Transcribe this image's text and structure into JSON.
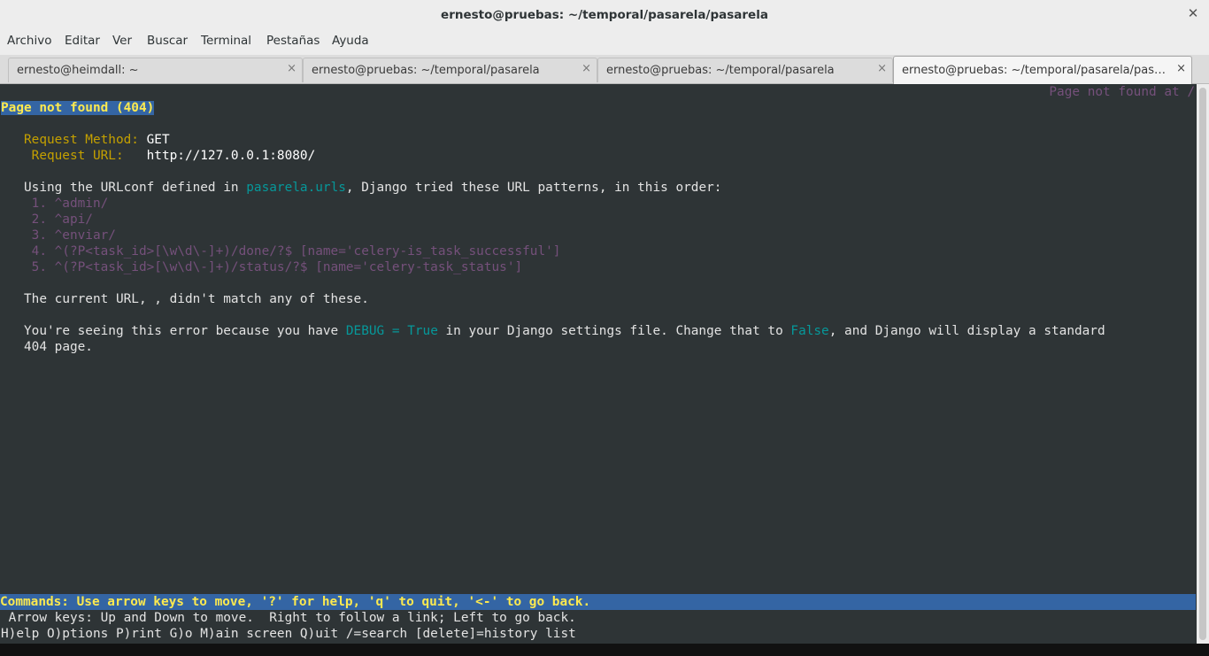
{
  "window": {
    "title": "ernesto@pruebas: ~/temporal/pasarela/pasarela",
    "close_glyph": "✕"
  },
  "menu": [
    "Archivo",
    "Editar",
    "Ver",
    "Buscar",
    "Terminal",
    "Pestañas",
    "Ayuda"
  ],
  "tabs": [
    {
      "label": "ernesto@heimdall: ~",
      "close": "×"
    },
    {
      "label": "ernesto@pruebas: ~/temporal/pasarela",
      "close": "×"
    },
    {
      "label": "ernesto@pruebas: ~/temporal/pasarela",
      "close": "×"
    },
    {
      "label": "ernesto@pruebas: ~/temporal/pasarela/pasarela",
      "close": "×",
      "active": true
    }
  ],
  "terminal": {
    "right_header": "Page not found at /",
    "heading": "Page not found (404)",
    "request_method_label": "Request Method:",
    "request_method_value": "GET",
    "request_url_label": "Request URL:",
    "request_url_value": "http://127.0.0.1:8080/",
    "urlconf_prefix": "Using the URLconf defined in ",
    "urlconf_module": "pasarela.urls",
    "urlconf_suffix": ", Django tried these URL patterns, in this order:",
    "patterns": [
      "1. ^admin/",
      "2. ^api/",
      "3. ^enviar/",
      "4. ^(?P<task_id>[\\w\\d\\-]+)/done/?$ [name='celery-is_task_successful']",
      "5. ^(?P<task_id>[\\w\\d\\-]+)/status/?$ [name='celery-task_status']"
    ],
    "no_match": "The current URL, , didn't match any of these.",
    "debug_prefix": "You're seeing this error because you have ",
    "debug_setting": "DEBUG = True",
    "debug_middle": " in your Django settings file. Change that to ",
    "debug_false": "False",
    "debug_suffix": ", and Django will display a standard",
    "debug_line2": "404 page.",
    "command_bar": "Commands: Use arrow keys to move, '?' for help, 'q' to quit, '<-' to go back.",
    "help_line1": " Arrow keys: Up and Down to move.  Right to follow a link; Left to go back.",
    "help_line2": "H)elp O)ptions P)rint G)o M)ain screen Q)uit /=search [delete]=history list"
  },
  "colors": {
    "terminal_bg": "#2e3436",
    "label_yellow": "#c4a000",
    "link_cyan": "#06989a",
    "dim_purple": "#75507b",
    "highlight_blue": "#3465a4",
    "highlight_text": "#fce94f"
  }
}
